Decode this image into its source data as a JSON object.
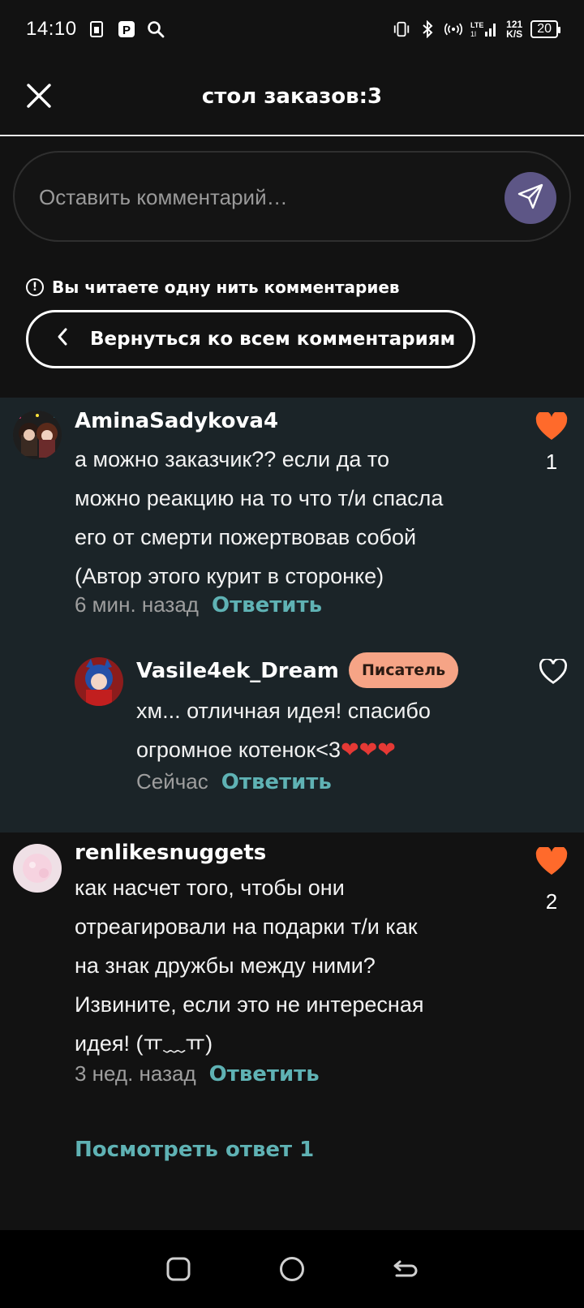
{
  "status_bar": {
    "time": "14:10",
    "icons": [
      "sim-icon",
      "p-app-icon",
      "search-icon"
    ],
    "right_icons": [
      "vibrate-icon",
      "bluetooth-icon",
      "hotspot-icon",
      "lte-signal-icon"
    ],
    "network_speed": "121\nK/S",
    "battery": "20"
  },
  "header": {
    "title": "стол заказов:3",
    "close_icon": "close-icon"
  },
  "composer": {
    "placeholder": "Оставить комментарий…",
    "send_icon": "send-icon",
    "send_button_color": "#5d5686"
  },
  "thread_notice": {
    "text": "Вы читаете одну нить комментариев"
  },
  "back_button": {
    "label": "Вернуться ко всем комментариям"
  },
  "comments": [
    {
      "username": "AminaSadykova4",
      "lines": [
        "а можно заказчик?? если да то",
        "можно реакцию на то что т/и спасла",
        "его от смерти пожертвовав собой",
        "(Автор этого курит в сторонке)"
      ],
      "time": "6 мин. назад",
      "reply_label": "Ответить",
      "likes": "1",
      "liked": true,
      "reply": {
        "username": "Vasile4ek_Dream",
        "badge": "Писатель",
        "lines": [
          "хм... отличная идея! спасибо",
          "огромное котенок<3❤️❤️❤️"
        ],
        "line2_text": "огромное котенок<3",
        "line2_emojis": "❤❤❤",
        "time": "Сейчас",
        "reply_label": "Ответить",
        "liked": false
      }
    },
    {
      "username": "renlikesnuggets",
      "lines": [
        "как насчет того, чтобы они",
        "отреагировали на подарки т/и как",
        "на знак дружбы между ними?",
        "Извините, если это не интересная",
        "идея! (ㅠ﹏ㅠ)"
      ],
      "time": "3 нед. назад",
      "reply_label": "Ответить",
      "likes": "2",
      "liked": true,
      "view_replies": "Посмотреть ответ 1"
    }
  ],
  "colors": {
    "accent_link": "#5fb2b4",
    "like_active": "#ff6a2b",
    "badge_bg": "#f6a486",
    "thread_bg": "#1b2428",
    "page_bg": "#121212"
  },
  "nav_bar": {
    "icons": [
      "recents-icon",
      "home-icon",
      "back-icon"
    ]
  }
}
